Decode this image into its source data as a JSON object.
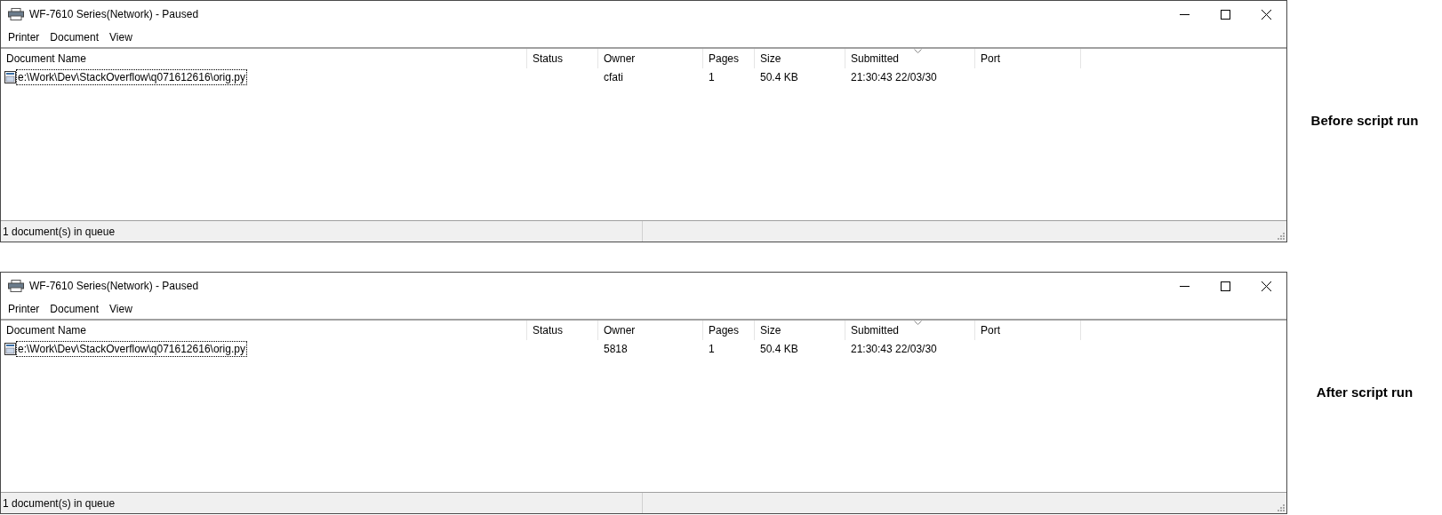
{
  "sections": [
    {
      "window": {
        "title": "WF-7610 Series(Network) - Paused",
        "menu": [
          "Printer",
          "Document",
          "View"
        ],
        "columns": [
          {
            "label": "Document Name",
            "sorted": false
          },
          {
            "label": "Status",
            "sorted": false
          },
          {
            "label": "Owner",
            "sorted": false
          },
          {
            "label": "Pages",
            "sorted": false
          },
          {
            "label": "Size",
            "sorted": false
          },
          {
            "label": "Submitted",
            "sorted": true
          },
          {
            "label": "Port",
            "sorted": false
          }
        ],
        "rows": [
          {
            "focused": true,
            "cells": [
              "e:\\Work\\Dev\\StackOverflow\\q071612616\\orig.py",
              "",
              "cfati",
              "1",
              "50.4 KB",
              "21:30:43  22/03/30",
              ""
            ]
          }
        ],
        "status": "1 document(s) in queue"
      },
      "caption": "Before script run"
    },
    {
      "window": {
        "title": "WF-7610 Series(Network) - Paused",
        "menu": [
          "Printer",
          "Document",
          "View"
        ],
        "columns": [
          {
            "label": "Document Name",
            "sorted": false
          },
          {
            "label": "Status",
            "sorted": false
          },
          {
            "label": "Owner",
            "sorted": false
          },
          {
            "label": "Pages",
            "sorted": false
          },
          {
            "label": "Size",
            "sorted": false
          },
          {
            "label": "Submitted",
            "sorted": true
          },
          {
            "label": "Port",
            "sorted": false
          }
        ],
        "rows": [
          {
            "focused": true,
            "cells": [
              "e:\\Work\\Dev\\StackOverflow\\q071612616\\orig.py",
              "",
              "5818",
              "1",
              "50.4 KB",
              "21:30:43  22/03/30",
              ""
            ]
          }
        ],
        "status": "1 document(s) in queue"
      },
      "caption": "After script run"
    }
  ]
}
